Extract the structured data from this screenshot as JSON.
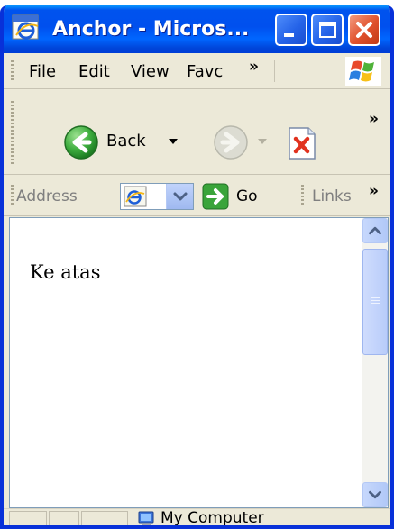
{
  "window": {
    "title": "Anchor - Micros..."
  },
  "menu": {
    "items": [
      "File",
      "Edit",
      "View",
      "Favc"
    ],
    "overflow": "»"
  },
  "toolbar": {
    "back_label": "Back",
    "overflow": "»"
  },
  "address_bar": {
    "label": "Address",
    "go_label": "Go",
    "links_label": "Links",
    "overflow": "»"
  },
  "page": {
    "body_text": "Ke atas"
  },
  "status_bar": {
    "zone_label": "My Computer"
  },
  "colors": {
    "titlebar_blue": "#0050ee",
    "close_red": "#e0512c",
    "back_green": "#3fae3f",
    "chrome_beige": "#ece9d8"
  }
}
